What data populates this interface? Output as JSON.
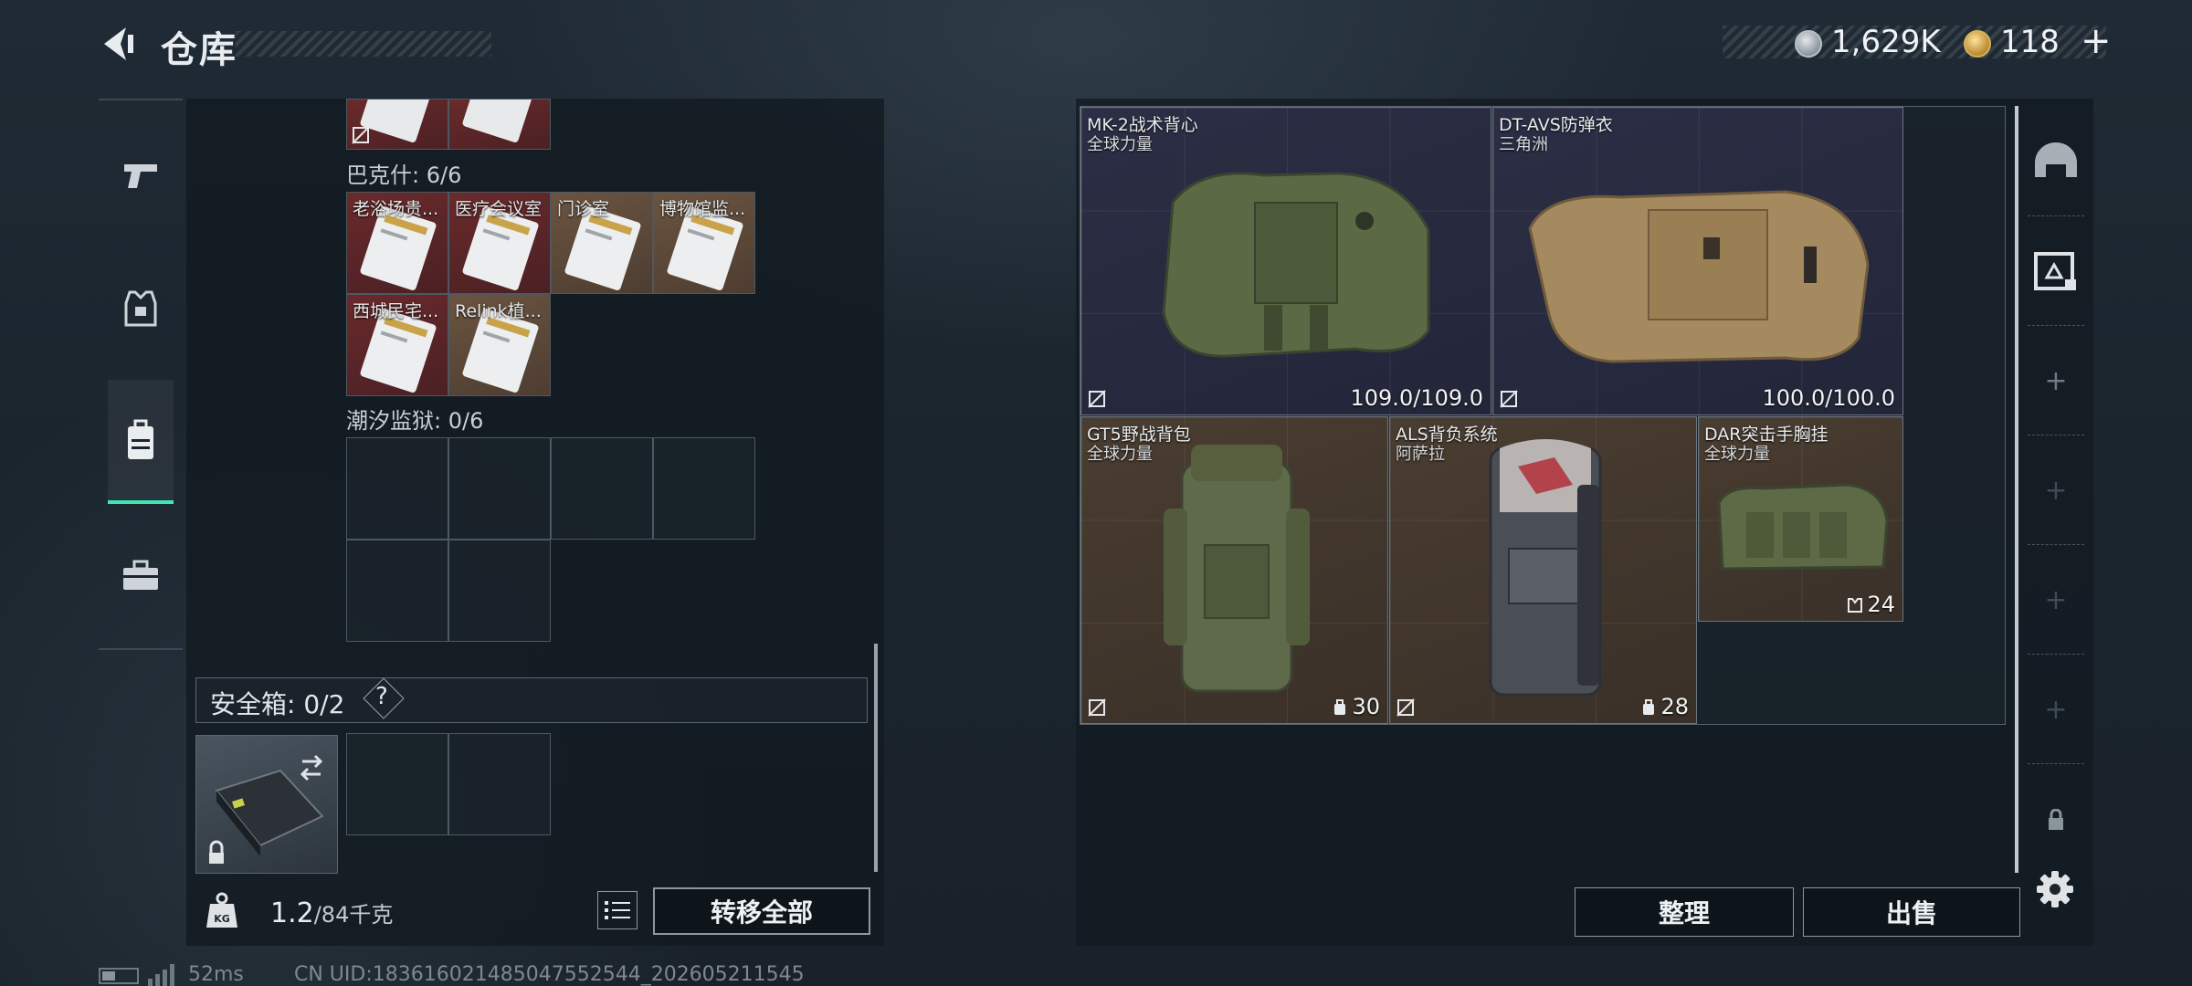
{
  "header": {
    "title": "仓库",
    "currency_silver": "1,629K",
    "currency_gold": "118",
    "plus_label": "+"
  },
  "stash": {
    "sections": [
      {
        "label": "巴克什: 6/6",
        "cards": [
          {
            "label": "老浴场贵...",
            "color": "red"
          },
          {
            "label": "医疗会议室",
            "color": "red"
          },
          {
            "label": "门诊室",
            "color": "tan"
          },
          {
            "label": "博物馆监...",
            "color": "tan"
          },
          {
            "label": "西城民宅...",
            "color": "red"
          },
          {
            "label": "Relink植...",
            "color": "tan"
          }
        ]
      },
      {
        "label": "潮汐监狱: 0/6",
        "cards": []
      }
    ],
    "safe_box_label": "安全箱: 0/2",
    "safe_box_help": "?",
    "weight_value": "1.2",
    "weight_capacity": "/84千克",
    "transfer_all_label": "转移全部"
  },
  "container": {
    "items": [
      {
        "name": "MK-2战术背心",
        "sub": "全球力量",
        "value": "109.0/109.0",
        "rarity": "purple"
      },
      {
        "name": "DT-AVS防弹衣",
        "sub": "三角洲",
        "value": "100.0/100.0",
        "rarity": "purple"
      },
      {
        "name": "GT5野战背包",
        "sub": "全球力量",
        "value": "30",
        "rarity": "brown"
      },
      {
        "name": "ALS背负系统",
        "sub": "阿萨拉",
        "value": "28",
        "rarity": "brown"
      },
      {
        "name": "DAR突击手胸挂",
        "sub": "全球力量",
        "value": "24",
        "rarity": "brown"
      }
    ],
    "sort_label": "整理",
    "sell_label": "出售"
  },
  "status": {
    "ping": "52ms",
    "uid": "CN UID:1836160214850475525​44_202605211545"
  },
  "colors": {
    "accent": "#3ee6b0",
    "rarity_purple": "#2c2e45",
    "rarity_brown": "#4a3d31",
    "card_red": "#6a2a2b",
    "card_tan": "#6b5440"
  },
  "icons": {
    "back": "back-arrow-icon",
    "nav": [
      "pistol-icon",
      "armor-vest-icon",
      "backpack-icon",
      "briefcase-icon"
    ],
    "rail": [
      "helmet-icon",
      "safe-box-icon",
      "plus-icon",
      "plus-icon",
      "plus-icon",
      "plus-icon",
      "lock-icon"
    ],
    "settings": "gear-icon"
  }
}
